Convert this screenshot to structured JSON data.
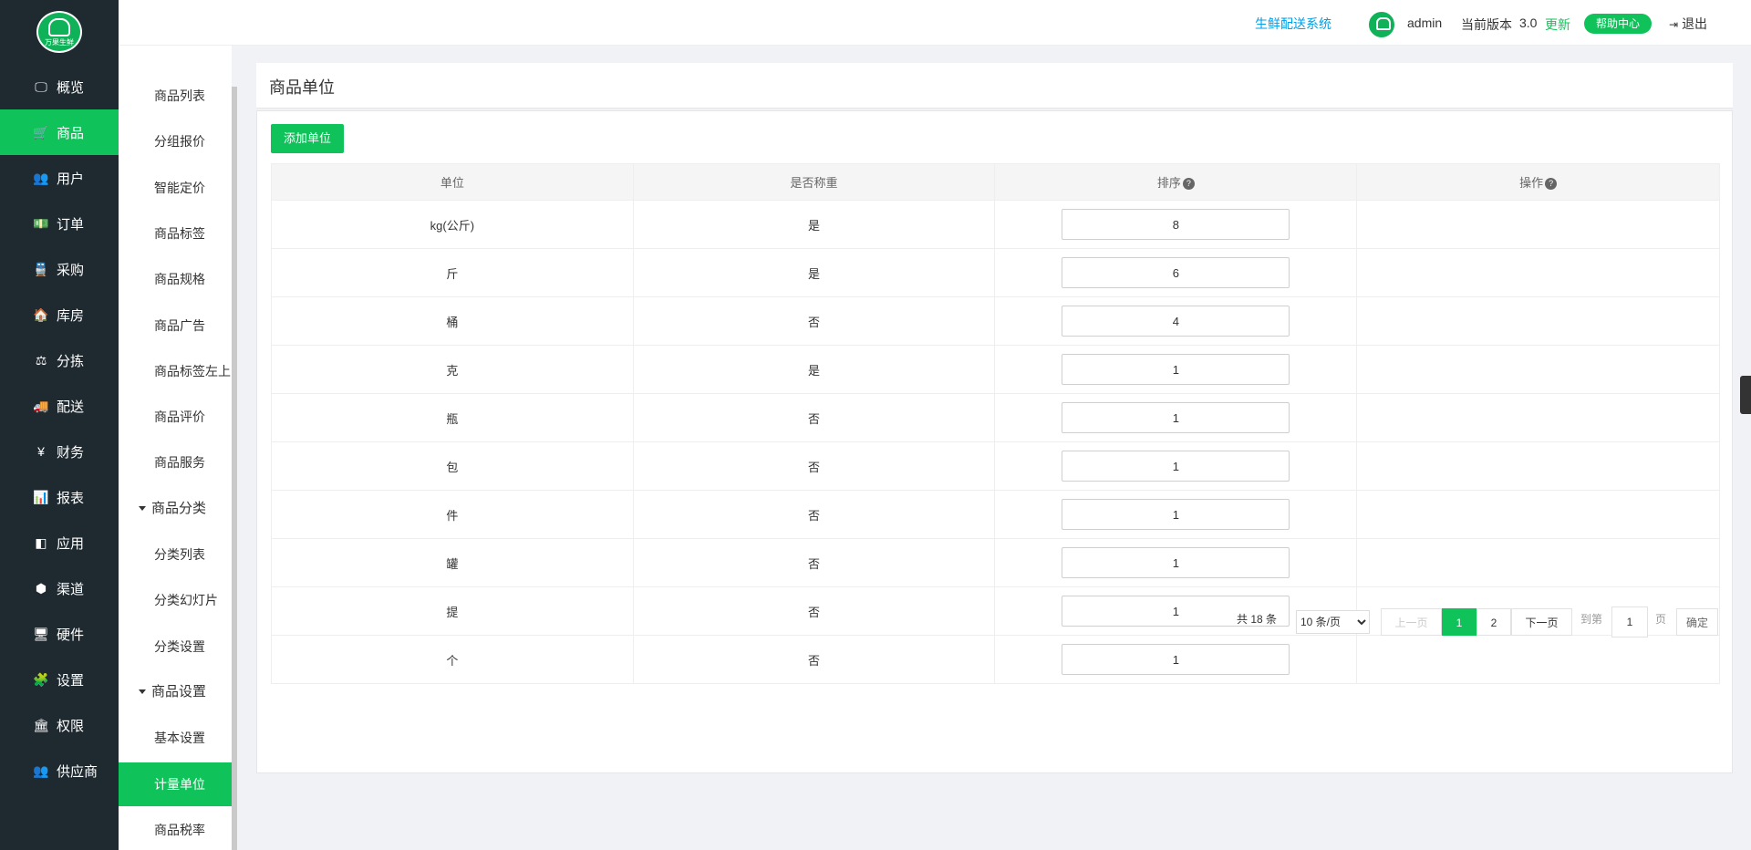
{
  "logo": {
    "text": "万果生鲜"
  },
  "nav": [
    {
      "label": "概览",
      "icon": "monitor-icon",
      "glyph": "🖵",
      "active": false
    },
    {
      "label": "商品",
      "icon": "cart-icon",
      "glyph": "🛒",
      "active": true
    },
    {
      "label": "用户",
      "icon": "users-icon",
      "glyph": "👥",
      "active": false
    },
    {
      "label": "订单",
      "icon": "money-icon",
      "glyph": "💵",
      "active": false
    },
    {
      "label": "采购",
      "icon": "train-icon",
      "glyph": "🚆",
      "active": false
    },
    {
      "label": "库房",
      "icon": "home-icon",
      "glyph": "🏠",
      "active": false
    },
    {
      "label": "分拣",
      "icon": "scale-icon",
      "glyph": "⚖",
      "active": false
    },
    {
      "label": "配送",
      "icon": "truck-icon",
      "glyph": "🚚",
      "active": false
    },
    {
      "label": "财务",
      "icon": "yen-icon",
      "glyph": "¥",
      "active": false
    },
    {
      "label": "报表",
      "icon": "bar-chart-icon",
      "glyph": "📊",
      "active": false
    },
    {
      "label": "应用",
      "icon": "apps-icon",
      "glyph": "◧",
      "active": false
    },
    {
      "label": "渠道",
      "icon": "cube-icon",
      "glyph": "⬢",
      "active": false
    },
    {
      "label": "硬件",
      "icon": "desktop-icon",
      "glyph": "🖥",
      "active": false
    },
    {
      "label": "设置",
      "icon": "puzzle-icon",
      "glyph": "🧩",
      "active": false
    },
    {
      "label": "权限",
      "icon": "bank-icon",
      "glyph": "🏛",
      "active": false
    },
    {
      "label": "供应商",
      "icon": "supplier-icon",
      "glyph": "👥",
      "active": false
    }
  ],
  "subnav": [
    {
      "label": "商品列表",
      "group": false,
      "active": false
    },
    {
      "label": "分组报价",
      "group": false,
      "active": false
    },
    {
      "label": "智能定价",
      "group": false,
      "active": false
    },
    {
      "label": "商品标签",
      "group": false,
      "active": false
    },
    {
      "label": "商品规格",
      "group": false,
      "active": false
    },
    {
      "label": "商品广告",
      "group": false,
      "active": false
    },
    {
      "label": "商品标签左上",
      "group": false,
      "active": false
    },
    {
      "label": "商品评价",
      "group": false,
      "active": false
    },
    {
      "label": "商品服务",
      "group": false,
      "active": false
    },
    {
      "label": "商品分类",
      "group": true,
      "active": false
    },
    {
      "label": "分类列表",
      "group": false,
      "active": false
    },
    {
      "label": "分类幻灯片",
      "group": false,
      "active": false
    },
    {
      "label": "分类设置",
      "group": false,
      "active": false
    },
    {
      "label": "商品设置",
      "group": true,
      "active": false
    },
    {
      "label": "基本设置",
      "group": false,
      "active": false
    },
    {
      "label": "计量单位",
      "group": false,
      "active": true
    },
    {
      "label": "商品税率",
      "group": false,
      "active": false
    }
  ],
  "header": {
    "system_link": "生鲜配送系统",
    "username": "admin",
    "version_label": "当前版本",
    "version": "3.0",
    "update": "更新",
    "help": "帮助中心",
    "logout": "退出"
  },
  "page": {
    "title": "商品单位",
    "add_button": "添加单位"
  },
  "table": {
    "headers": [
      "单位",
      "是否称重",
      "排序",
      "操作"
    ],
    "help_mark": "?",
    "rows": [
      {
        "unit": "kg(公斤)",
        "weighed": "是",
        "sort": "8"
      },
      {
        "unit": "斤",
        "weighed": "是",
        "sort": "6"
      },
      {
        "unit": "桶",
        "weighed": "否",
        "sort": "4"
      },
      {
        "unit": "克",
        "weighed": "是",
        "sort": "1"
      },
      {
        "unit": "瓶",
        "weighed": "否",
        "sort": "1"
      },
      {
        "unit": "包",
        "weighed": "否",
        "sort": "1"
      },
      {
        "unit": "件",
        "weighed": "否",
        "sort": "1"
      },
      {
        "unit": "罐",
        "weighed": "否",
        "sort": "1"
      },
      {
        "unit": "提",
        "weighed": "否",
        "sort": "1"
      },
      {
        "unit": "个",
        "weighed": "否",
        "sort": "1"
      }
    ]
  },
  "pagination": {
    "total": "共 18 条",
    "page_size": "10 条/页",
    "prev": "上一页",
    "pages": [
      "1",
      "2"
    ],
    "next": "下一页",
    "goto": "到第",
    "goto_value": "1",
    "page_suffix": "页",
    "confirm": "确定"
  },
  "colors": {
    "accent": "#0fc35a",
    "sidebar": "#1f2a30",
    "link": "#00a0e9"
  }
}
